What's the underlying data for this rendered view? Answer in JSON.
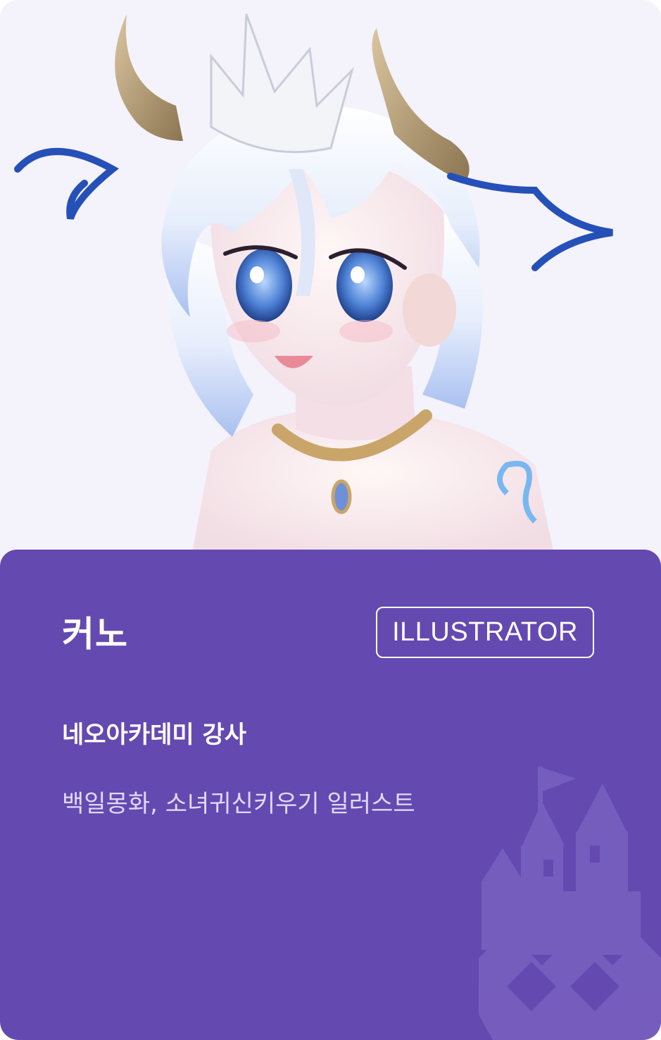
{
  "portrait": {
    "alt": "커노 illustration",
    "background": "#f4f2fb"
  },
  "profile": {
    "name": "커노",
    "role": "ILLUSTRATOR",
    "subtitle": "네오아카데미 강사",
    "description": "백일몽화, 소녀귀신키우기 일러스트"
  },
  "colors": {
    "panel": "#6449b1",
    "text": "#ffffff",
    "muted_text": "#e2d8f8",
    "watermark": "#7a62c0"
  },
  "icons": {
    "watermark": "castle-watermark-icon"
  }
}
